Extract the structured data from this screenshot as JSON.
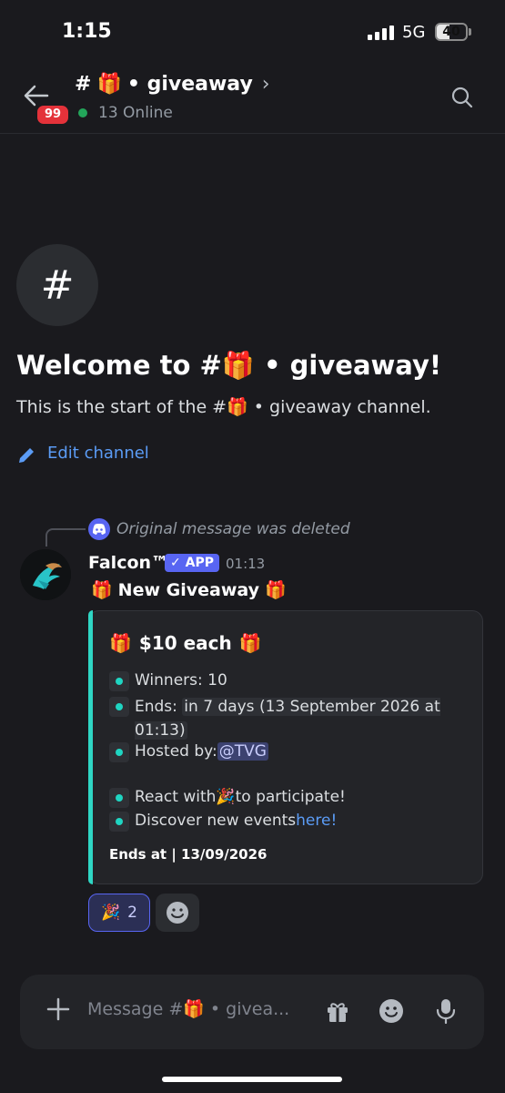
{
  "status_bar": {
    "time": "1:15",
    "network": "5G",
    "battery": "40"
  },
  "header": {
    "hash": "#",
    "gift_emoji": "🎁",
    "channel_name": "• giveaway",
    "chevron": "›",
    "unread_badge": "99",
    "online": "13 Online"
  },
  "welcome": {
    "hash_symbol": "#",
    "title": "Welcome to #🎁 • giveaway!",
    "subtitle": "This is the start of the #🎁 • giveaway channel.",
    "edit_link": "Edit channel"
  },
  "message": {
    "reply_note": "Original message was deleted",
    "author": "Falcon™",
    "app_tag": "✓ APP",
    "time": "01:13",
    "content": "New Giveaway",
    "content_emoji": "🎁",
    "embed": {
      "title": "$10 each",
      "title_emoji": "🎁",
      "winners": "Winners: 10",
      "ends_label": "Ends: ",
      "ends_value": "in 7 days (13 September 2026 at 01:13)",
      "hosted_label": "Hosted by: ",
      "hosted_mention": "@TVG",
      "react_prefix": "React with ",
      "react_emoji": "🎉",
      "react_suffix": " to participate!",
      "discover_prefix": "Discover new events ",
      "discover_link": "here!",
      "ends_at": "Ends at | 13/09/2026"
    },
    "reaction": {
      "emoji": "🎉",
      "count": "2"
    }
  },
  "composer": {
    "placeholder": "Message #🎁 • givea..."
  }
}
